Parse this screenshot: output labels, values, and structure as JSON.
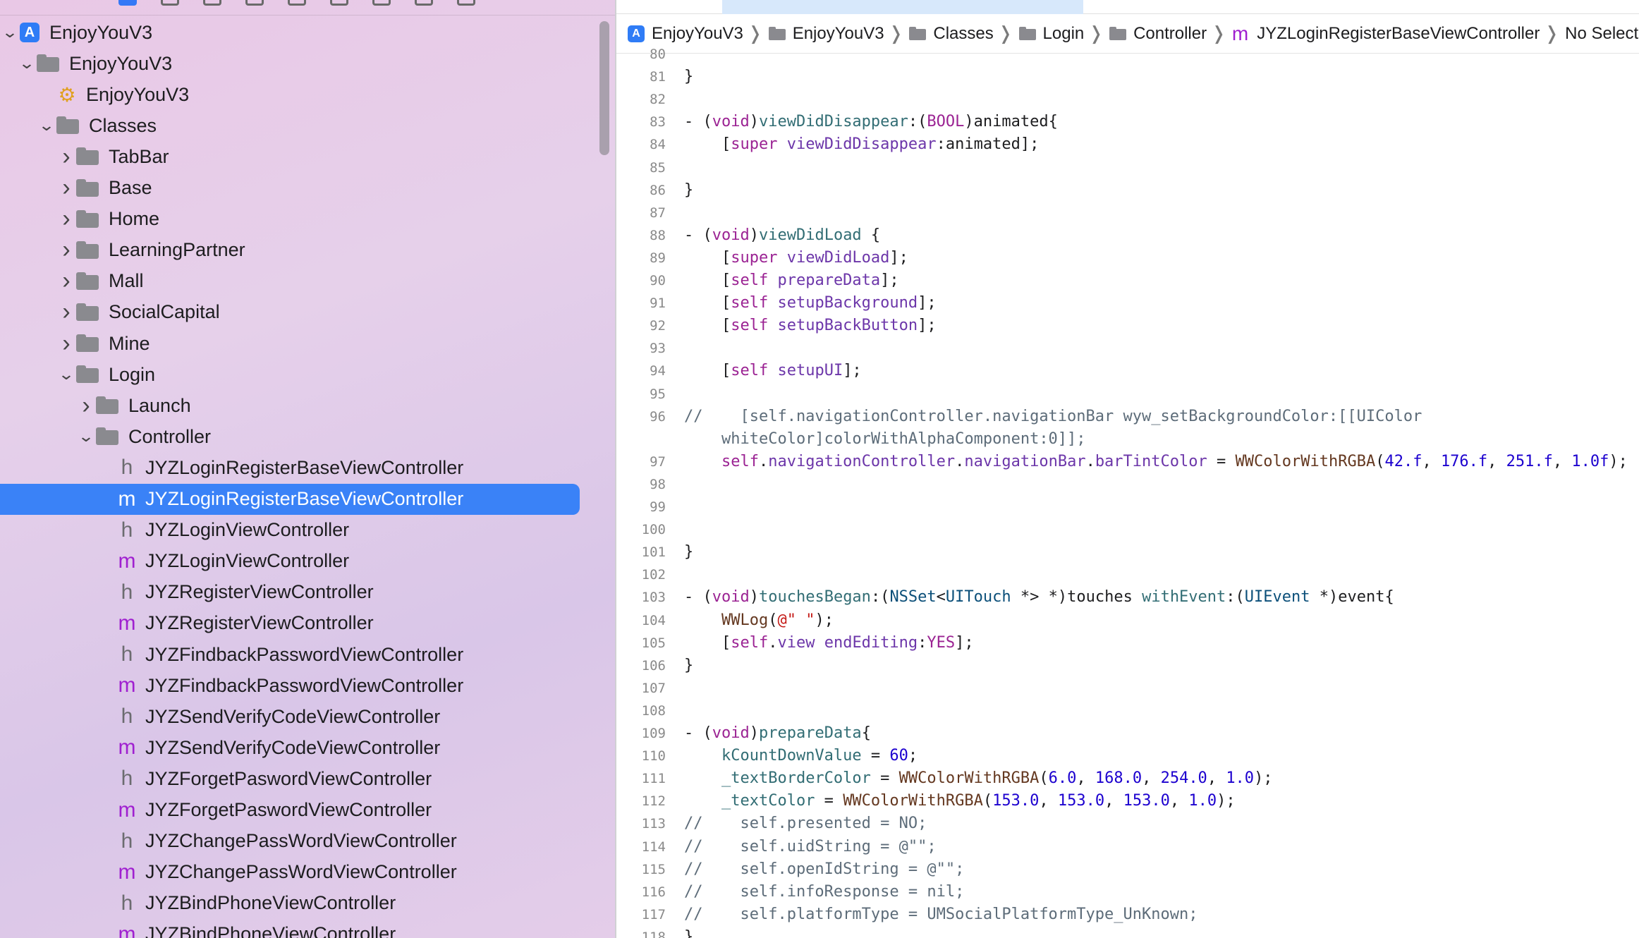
{
  "navigator": {
    "items": [
      {
        "label": "EnjoyYouV3",
        "kind": "project",
        "depth": 0,
        "expanded": true
      },
      {
        "label": "EnjoyYouV3",
        "kind": "folder",
        "depth": 1,
        "expanded": true
      },
      {
        "label": "EnjoyYouV3",
        "kind": "target",
        "depth": 2
      },
      {
        "label": "Classes",
        "kind": "folder",
        "depth": 2,
        "expanded": true
      },
      {
        "label": "TabBar",
        "kind": "folder",
        "depth": 3,
        "expanded": false
      },
      {
        "label": "Base",
        "kind": "folder",
        "depth": 3,
        "expanded": false
      },
      {
        "label": "Home",
        "kind": "folder",
        "depth": 3,
        "expanded": false
      },
      {
        "label": "LearningPartner",
        "kind": "folder",
        "depth": 3,
        "expanded": false
      },
      {
        "label": "Mall",
        "kind": "folder",
        "depth": 3,
        "expanded": false
      },
      {
        "label": "SocialCapital",
        "kind": "folder",
        "depth": 3,
        "expanded": false
      },
      {
        "label": "Mine",
        "kind": "folder",
        "depth": 3,
        "expanded": false
      },
      {
        "label": "Login",
        "kind": "folder",
        "depth": 3,
        "expanded": true
      },
      {
        "label": "Launch",
        "kind": "folder",
        "depth": 4,
        "expanded": false
      },
      {
        "label": "Controller",
        "kind": "folder",
        "depth": 4,
        "expanded": true
      },
      {
        "label": "JYZLoginRegisterBaseViewController",
        "kind": "h",
        "depth": 5
      },
      {
        "label": "JYZLoginRegisterBaseViewController",
        "kind": "m",
        "depth": 5,
        "selected": true
      },
      {
        "label": "JYZLoginViewController",
        "kind": "h",
        "depth": 5
      },
      {
        "label": "JYZLoginViewController",
        "kind": "m",
        "depth": 5
      },
      {
        "label": "JYZRegisterViewController",
        "kind": "h",
        "depth": 5
      },
      {
        "label": "JYZRegisterViewController",
        "kind": "m",
        "depth": 5
      },
      {
        "label": "JYZFindbackPasswordViewController",
        "kind": "h",
        "depth": 5
      },
      {
        "label": "JYZFindbackPasswordViewController",
        "kind": "m",
        "depth": 5
      },
      {
        "label": "JYZSendVerifyCodeViewController",
        "kind": "h",
        "depth": 5
      },
      {
        "label": "JYZSendVerifyCodeViewController",
        "kind": "m",
        "depth": 5
      },
      {
        "label": "JYZForgetPaswordViewController",
        "kind": "h",
        "depth": 5
      },
      {
        "label": "JYZForgetPaswordViewController",
        "kind": "m",
        "depth": 5
      },
      {
        "label": "JYZChangePassWordViewController",
        "kind": "h",
        "depth": 5
      },
      {
        "label": "JYZChangePassWordViewController",
        "kind": "m",
        "depth": 5
      },
      {
        "label": "JYZBindPhoneViewController",
        "kind": "h",
        "depth": 5
      },
      {
        "label": "JYZBindPhoneViewController",
        "kind": "m",
        "depth": 5
      }
    ]
  },
  "jumpbar": {
    "crumbs": [
      {
        "label": "EnjoyYouV3",
        "kind": "project"
      },
      {
        "label": "EnjoyYouV3",
        "kind": "folder"
      },
      {
        "label": "Classes",
        "kind": "folder"
      },
      {
        "label": "Login",
        "kind": "folder"
      },
      {
        "label": "Controller",
        "kind": "folder"
      },
      {
        "label": "JYZLoginRegisterBaseViewController",
        "kind": "m"
      },
      {
        "label": "No Selection",
        "kind": "text"
      }
    ]
  },
  "code": {
    "lines": [
      {
        "n": "80",
        "html": ""
      },
      {
        "n": "81",
        "html": "}"
      },
      {
        "n": "82",
        "html": ""
      },
      {
        "n": "83",
        "html": "- (<span class=\"kw\">void</span>)<span class=\"fn\">viewDidDisappear</span>:(<span class=\"kw\">BOOL</span>)animated{"
      },
      {
        "n": "84",
        "html": "    [<span class=\"kw\">super</span> <span class=\"prop\">viewDidDisappear</span>:animated];"
      },
      {
        "n": "85",
        "html": ""
      },
      {
        "n": "86",
        "html": "}"
      },
      {
        "n": "87",
        "html": ""
      },
      {
        "n": "88",
        "html": "- (<span class=\"kw\">void</span>)<span class=\"fn\">viewDidLoad</span> {"
      },
      {
        "n": "89",
        "html": "    [<span class=\"kw\">super</span> <span class=\"prop\">viewDidLoad</span>];"
      },
      {
        "n": "90",
        "html": "    [<span class=\"kw\">self</span> <span class=\"prop\">prepareData</span>];"
      },
      {
        "n": "91",
        "html": "    [<span class=\"kw\">self</span> <span class=\"prop\">setupBackground</span>];"
      },
      {
        "n": "92",
        "html": "    [<span class=\"kw\">self</span> <span class=\"prop\">setupBackButton</span>];"
      },
      {
        "n": "93",
        "html": ""
      },
      {
        "n": "94",
        "html": "    [<span class=\"kw\">self</span> <span class=\"prop\">setupUI</span>];"
      },
      {
        "n": "95",
        "html": ""
      },
      {
        "n": "96",
        "html": "<span class=\"cm\">//    [self.navigationController.navigationBar wyw_setBackgroundColor:[[UIColor</span>"
      },
      {
        "n": "",
        "html": "<span class=\"cm\">    whiteColor]colorWithAlphaComponent:0]];</span>"
      },
      {
        "n": "97",
        "html": "    <span class=\"kw\">self</span>.<span class=\"prop\">navigationController</span>.<span class=\"prop\">navigationBar</span>.<span class=\"prop\">barTintColor</span> = <span class=\"macro\">WWColorWithRGBA</span>(<span class=\"num\">42.f</span>, <span class=\"num\">176.f</span>, <span class=\"num\">251.f</span>, <span class=\"num\">1.0f</span>);"
      },
      {
        "n": "98",
        "html": ""
      },
      {
        "n": "99",
        "html": ""
      },
      {
        "n": "100",
        "html": ""
      },
      {
        "n": "101",
        "html": "}"
      },
      {
        "n": "102",
        "html": ""
      },
      {
        "n": "103",
        "html": "- (<span class=\"kw\">void</span>)<span class=\"fn\">touchesBegan</span>:(<span class=\"cls\">NSSet</span>&lt;<span class=\"cls\">UITouch</span> *&gt; *)touches <span class=\"fn\">withEvent</span>:(<span class=\"cls\">UIEvent</span> *)event{"
      },
      {
        "n": "104",
        "html": "    <span class=\"macro\">WWLog</span>(<span class=\"str\">@\" \"</span>);"
      },
      {
        "n": "105",
        "html": "    [<span class=\"kw\">self</span>.<span class=\"prop\">view</span> <span class=\"prop\">endEditing</span>:<span class=\"kw\">YES</span>];"
      },
      {
        "n": "106",
        "html": "}"
      },
      {
        "n": "107",
        "html": ""
      },
      {
        "n": "108",
        "html": ""
      },
      {
        "n": "109",
        "html": "- (<span class=\"kw\">void</span>)<span class=\"fn\">prepareData</span>{"
      },
      {
        "n": "110",
        "html": "    <span class=\"fn\">kCountDownValue</span> = <span class=\"num\">60</span>;"
      },
      {
        "n": "111",
        "html": "    <span class=\"fn\">_textBorderColor</span> = <span class=\"macro\">WWColorWithRGBA</span>(<span class=\"num\">6.0</span>, <span class=\"num\">168.0</span>, <span class=\"num\">254.0</span>, <span class=\"num\">1.0</span>);"
      },
      {
        "n": "112",
        "html": "    <span class=\"fn\">_textColor</span> = <span class=\"macro\">WWColorWithRGBA</span>(<span class=\"num\">153.0</span>, <span class=\"num\">153.0</span>, <span class=\"num\">153.0</span>, <span class=\"num\">1.0</span>);"
      },
      {
        "n": "113",
        "html": "<span class=\"cm\">//    self.presented = NO;</span>"
      },
      {
        "n": "114",
        "html": "<span class=\"cm\">//    self.uidString = @\"\";</span>"
      },
      {
        "n": "115",
        "html": "<span class=\"cm\">//    self.openIdString = @\"\";</span>"
      },
      {
        "n": "116",
        "html": "<span class=\"cm\">//    self.infoResponse = nil;</span>"
      },
      {
        "n": "117",
        "html": "<span class=\"cm\">//    self.platformType = UMSocialPlatformType_UnKnown;</span>"
      },
      {
        "n": "118",
        "html": "}"
      }
    ]
  }
}
